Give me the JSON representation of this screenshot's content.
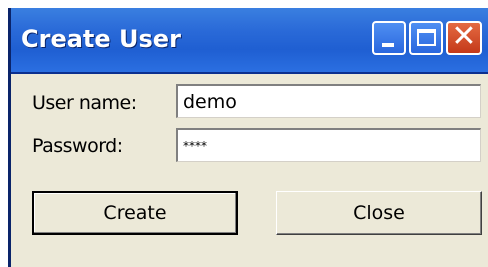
{
  "window": {
    "title": "Create User"
  },
  "titlebar": {
    "buttons": [
      {
        "name": "minimize",
        "icon": "minimize-icon"
      },
      {
        "name": "maximize",
        "icon": "maximize-icon"
      },
      {
        "name": "close",
        "icon": "close-icon",
        "glyph": "✕"
      }
    ]
  },
  "form": {
    "username_label": "User name:",
    "username_value": "demo",
    "password_label": "Password:",
    "password_value": "****"
  },
  "actions": {
    "create_label": "Create",
    "close_label": "Close"
  },
  "colors": {
    "titlebar": "#2a6ad8",
    "window_bg": "#ece9d8",
    "close_button": "#c4391a"
  }
}
